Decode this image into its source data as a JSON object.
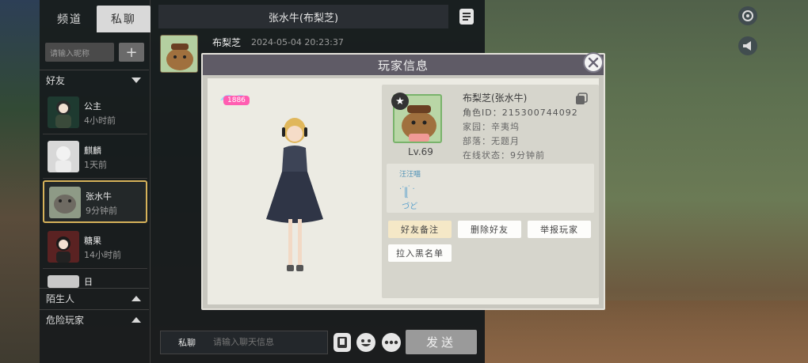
{
  "colors": {
    "panel_bg": "#14181c",
    "tab_active_bg": "#d9d9d9",
    "selected_border": "#d6b25a",
    "modal_header": "#5f5b66",
    "modal_body": "#ecebe3",
    "level_badge": "#ff5db1",
    "send_button": "#9a9a9a"
  },
  "tabs": [
    {
      "label": "频道"
    },
    {
      "label": "私聊"
    }
  ],
  "search": {
    "placeholder": "请输入昵称",
    "add_label": "+"
  },
  "sections": {
    "friends": "好友",
    "strangers": "陌生人",
    "dangerous": "危险玩家"
  },
  "friends": [
    {
      "name": "公主",
      "time": "4小时前"
    },
    {
      "name": "麒麟",
      "time": "1天前"
    },
    {
      "name": "张水牛",
      "time": "9分钟前"
    },
    {
      "name": "糖果",
      "time": "14小时前"
    },
    {
      "name": "日",
      "time": ""
    }
  ],
  "chat": {
    "title": "张水牛(布梨芝)",
    "message": {
      "sender": "布梨芝",
      "timestamp": "2024-05-04  20:23:37"
    },
    "input_label": "私聊",
    "input_placeholder": "请输入聊天信息",
    "send_label": "发送"
  },
  "modal": {
    "title": "玩家信息",
    "char_level": "1886",
    "player": {
      "name": "布梨芝(张水牛)",
      "role_id": "角色ID：215300744092",
      "home": "家园：辛夷坞",
      "tribe": "部落：无题月",
      "online_status": "在线状态：9分钟前",
      "level": "Lv.69"
    },
    "signature": {
      "title": "汪汪喵",
      "text": "·ॱ꧋ᐝ ·\n づど"
    },
    "actions": [
      {
        "label": "好友备注"
      },
      {
        "label": "删除好友"
      },
      {
        "label": "举报玩家"
      },
      {
        "label": "拉入黑名单"
      }
    ]
  },
  "icons": {
    "close": "close-icon",
    "copy": "copy-icon",
    "document": "document-icon",
    "emoji": "emoji-icon",
    "more": "more-icon",
    "voice": "voice-icon",
    "megaphone": "megaphone-icon",
    "settings": "settings-icon"
  }
}
